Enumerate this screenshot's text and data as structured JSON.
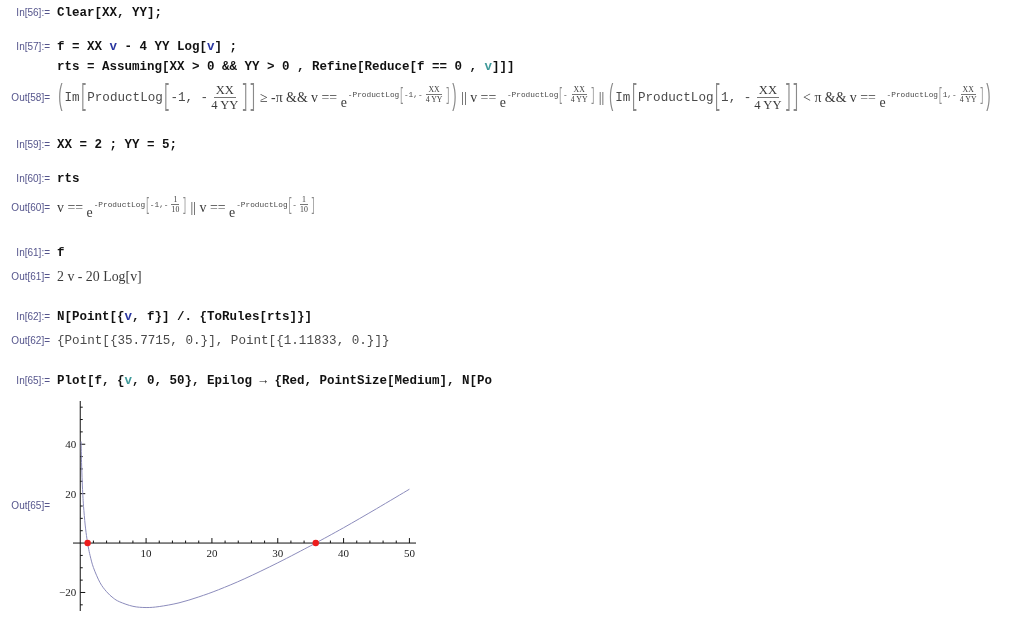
{
  "cells": [
    {
      "kind": "input",
      "label": "In[56]:=",
      "lines": [
        [
          {
            "kind": "plain",
            "text": "Clear[XX, YY];"
          }
        ]
      ]
    },
    {
      "kind": "input",
      "label": "In[57]:=",
      "lines": [
        [
          {
            "kind": "plain",
            "text": "f = XX "
          },
          {
            "kind": "global",
            "text": "v"
          },
          {
            "kind": "plain",
            "text": " - 4 YY Log["
          },
          {
            "kind": "global",
            "text": "v"
          },
          {
            "kind": "plain",
            "text": "] ;"
          }
        ],
        [
          {
            "kind": "plain",
            "text": "rts = Assuming[XX > 0 && YY > 0 , Refine[Reduce[f == 0 , "
          },
          {
            "kind": "local",
            "text": "v"
          },
          {
            "kind": "plain",
            "text": "]]]"
          }
        ]
      ]
    },
    {
      "kind": "output",
      "label": "Out[58]=",
      "expr": [
        {
          "kind": "fence",
          "open": "(",
          "close": ")",
          "items": [
            {
              "kind": "code",
              "text": "Im"
            },
            {
              "kind": "fence",
              "open": "[",
              "close": "]",
              "items": [
                {
                  "kind": "code",
                  "text": "ProductLog"
                },
                {
                  "kind": "fence",
                  "open": "[",
                  "close": "]",
                  "items": [
                    {
                      "kind": "code",
                      "text": "-1, -"
                    },
                    {
                      "kind": "frac",
                      "num": "XX",
                      "den": "4 YY"
                    }
                  ]
                }
              ]
            },
            {
              "kind": "math",
              "text": " ≥ -π && v == "
            },
            {
              "kind": "power",
              "base": "e",
              "exp": [
                {
                  "kind": "code",
                  "text": "-ProductLog"
                },
                {
                  "kind": "fence",
                  "open": "[",
                  "close": "]",
                  "items": [
                    {
                      "kind": "code",
                      "text": "-1,-"
                    },
                    {
                      "kind": "frac",
                      "num": "XX",
                      "den": "4 YY"
                    }
                  ]
                }
              ]
            }
          ]
        },
        {
          "kind": "math",
          "text": " || v == "
        },
        {
          "kind": "power",
          "base": "e",
          "exp": [
            {
              "kind": "code",
              "text": "-ProductLog"
            },
            {
              "kind": "fence",
              "open": "[",
              "close": "]",
              "items": [
                {
                  "kind": "code",
                  "text": "-"
                },
                {
                  "kind": "frac",
                  "num": "XX",
                  "den": "4 YY"
                }
              ]
            }
          ]
        },
        {
          "kind": "math",
          "text": " || "
        },
        {
          "kind": "fence",
          "open": "(",
          "close": ")",
          "items": [
            {
              "kind": "code",
              "text": "Im"
            },
            {
              "kind": "fence",
              "open": "[",
              "close": "]",
              "items": [
                {
                  "kind": "code",
                  "text": "ProductLog"
                },
                {
                  "kind": "fence",
                  "open": "[",
                  "close": "]",
                  "items": [
                    {
                      "kind": "code",
                      "text": "1, -"
                    },
                    {
                      "kind": "frac",
                      "num": "XX",
                      "den": "4 YY"
                    }
                  ]
                }
              ]
            },
            {
              "kind": "math",
              "text": " < π && v == "
            },
            {
              "kind": "power",
              "base": "e",
              "exp": [
                {
                  "kind": "code",
                  "text": "-ProductLog"
                },
                {
                  "kind": "fence",
                  "open": "[",
                  "close": "]",
                  "items": [
                    {
                      "kind": "code",
                      "text": "1,-"
                    },
                    {
                      "kind": "frac",
                      "num": "XX",
                      "den": "4 YY"
                    }
                  ]
                }
              ]
            }
          ]
        }
      ]
    },
    {
      "kind": "input",
      "label": "In[59]:=",
      "lines": [
        [
          {
            "kind": "plain",
            "text": "XX = 2 ; YY = 5;"
          }
        ]
      ]
    },
    {
      "kind": "input",
      "label": "In[60]:=",
      "lines": [
        [
          {
            "kind": "plain",
            "text": "rts"
          }
        ]
      ]
    },
    {
      "kind": "output",
      "label": "Out[60]=",
      "expr": [
        {
          "kind": "math",
          "text": "v == "
        },
        {
          "kind": "power",
          "base": "e",
          "exp": [
            {
              "kind": "code",
              "text": "-ProductLog"
            },
            {
              "kind": "fence",
              "open": "[",
              "close": "]",
              "items": [
                {
                  "kind": "code",
                  "text": "-1,-"
                },
                {
                  "kind": "frac",
                  "num": "1",
                  "den": "10"
                }
              ]
            }
          ]
        },
        {
          "kind": "math",
          "text": " || v == "
        },
        {
          "kind": "power",
          "base": "e",
          "exp": [
            {
              "kind": "code",
              "text": "-ProductLog"
            },
            {
              "kind": "fence",
              "open": "[",
              "close": "]",
              "items": [
                {
                  "kind": "code",
                  "text": "-"
                },
                {
                  "kind": "frac",
                  "num": "1",
                  "den": "10"
                }
              ]
            }
          ]
        }
      ]
    },
    {
      "kind": "input",
      "label": "In[61]:=",
      "lines": [
        [
          {
            "kind": "plain",
            "text": "f"
          }
        ]
      ]
    },
    {
      "kind": "output",
      "label": "Out[61]=",
      "expr": [
        {
          "kind": "math",
          "text": "2 v - 20 Log[v]"
        }
      ]
    },
    {
      "kind": "input",
      "label": "In[62]:=",
      "lines": [
        [
          {
            "kind": "plain",
            "text": "N[Point[{"
          },
          {
            "kind": "global",
            "text": "v"
          },
          {
            "kind": "plain",
            "text": ", f}] /. {ToRules[rts]}]"
          }
        ]
      ]
    },
    {
      "kind": "output",
      "label": "Out[62]=",
      "expr": [
        {
          "kind": "code",
          "text": "{Point[{35.7715, 0.}], Point[{1.11833, 0.}]}"
        }
      ]
    },
    {
      "kind": "input",
      "label": "In[65]:=",
      "lines": [
        [
          {
            "kind": "plain",
            "text": "Plot[f, {"
          },
          {
            "kind": "local",
            "text": "v"
          },
          {
            "kind": "plain",
            "text": ", 0, 50}, Epilog → {Red, PointSize[Medium], N[Po"
          }
        ]
      ]
    },
    {
      "kind": "plot",
      "label": "Out[65]=",
      "point_markers": true,
      "chart_data": {
        "type": "line",
        "x": [
          0.13,
          0.16,
          0.2,
          0.3,
          0.4,
          0.5,
          0.75,
          1,
          1.12,
          1.25,
          1.5,
          2,
          3,
          4,
          5,
          6,
          8,
          10,
          12,
          15,
          18,
          21,
          25,
          30,
          35,
          35.77,
          40,
          45,
          50
        ],
        "series": [
          {
            "color": "#8c8cbc",
            "values": [
              41.1,
              37,
              32.6,
              24.7,
              19.1,
              14.9,
              7.3,
              2,
              0,
              -2,
              -5.1,
              -9.9,
              -16,
              -19.7,
              -22.2,
              -23.8,
              -25.6,
              -26.1,
              -25.7,
              -24.2,
              -21.8,
              -18.9,
              -14.4,
              -8,
              -1.1,
              0,
              6.2,
              13.9,
              21.8
            ]
          }
        ],
        "xlim": [
          -1.1,
          51
        ],
        "ylim": [
          -27.5,
          57.5
        ],
        "xticks": [
          10,
          20,
          30,
          40,
          50
        ],
        "yticks": [
          {
            "value": -20,
            "label": "−20"
          },
          20,
          40
        ]
      }
    }
  ]
}
